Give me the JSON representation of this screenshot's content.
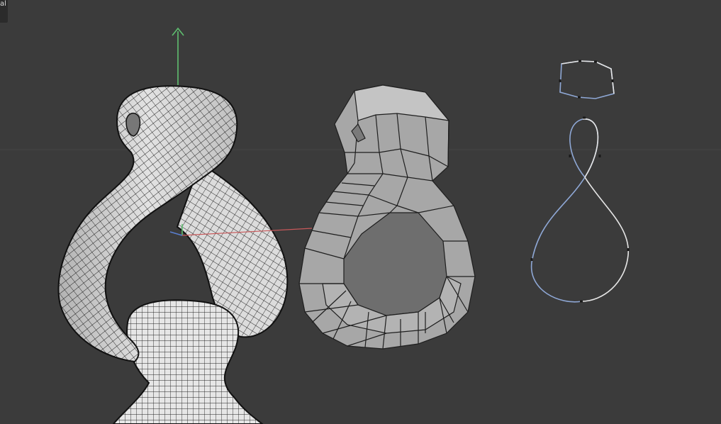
{
  "viewport": {
    "corner_label": "al",
    "background": "#3b3b3b",
    "colors": {
      "axis_y": "#5fbf70",
      "axis_x": "#c8585a",
      "axis_z": "#5a7fd0",
      "mesh_fill": "#d9d9d9",
      "wire": "#1a1a1a",
      "lowpoly_fill": "#a5a5a5",
      "spline_white": "#e6e6e6",
      "spline_blue": "#8fa8d6"
    },
    "objects": [
      {
        "name": "subdivided-knot-mesh",
        "shading": "wireframe-on-shaded"
      },
      {
        "name": "low-poly-knot-cage",
        "shading": "flat"
      },
      {
        "name": "profile-spline",
        "type": "spline"
      },
      {
        "name": "path-spline-figure-eight",
        "type": "spline"
      }
    ]
  }
}
